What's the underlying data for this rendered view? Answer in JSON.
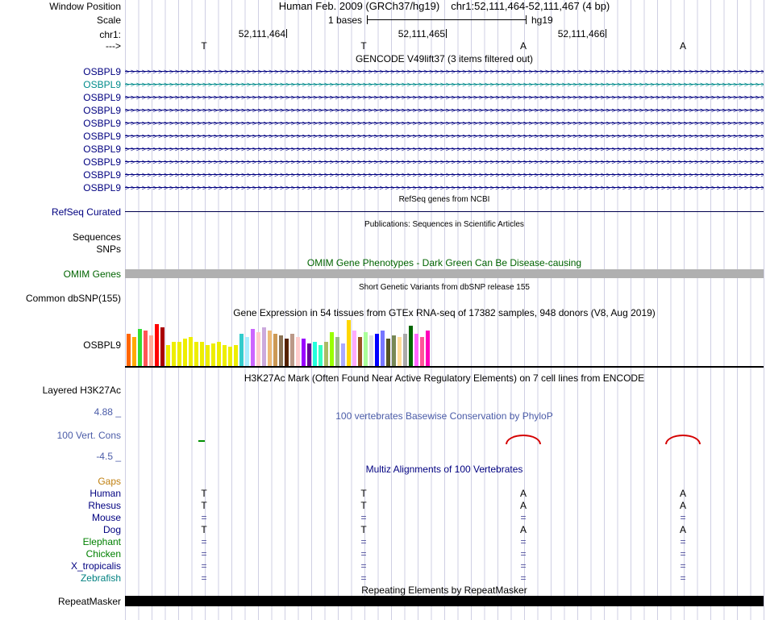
{
  "header": {
    "window_position_label": "Window Position",
    "assembly_title": "Human Feb. 2009 (GRCh37/hg19)",
    "position_title": "chr1:52,111,464-52,111,467 (4 bp)",
    "scale_label": "Scale",
    "scale_value": "1 bases",
    "assembly_tag": "hg19",
    "chrom_label": "chr1:",
    "coordinates": [
      "52,111,464",
      "52,111,465",
      "52,111,466"
    ],
    "strand_label": "--->",
    "bases": [
      "T",
      "T",
      "A",
      "A"
    ]
  },
  "tracks": {
    "gencode": {
      "title": "GENCODE V49lift37 (3 items filtered out)",
      "genes": [
        {
          "label": "OSBPL9",
          "color": "#000080"
        },
        {
          "label": "OSBPL9",
          "color": "#008b8b"
        },
        {
          "label": "OSBPL9",
          "color": "#000080"
        },
        {
          "label": "OSBPL9",
          "color": "#000080"
        },
        {
          "label": "OSBPL9",
          "color": "#000080"
        },
        {
          "label": "OSBPL9",
          "color": "#000080"
        },
        {
          "label": "OSBPL9",
          "color": "#000080"
        },
        {
          "label": "OSBPL9",
          "color": "#000080"
        },
        {
          "label": "OSBPL9",
          "color": "#000080"
        },
        {
          "label": "OSBPL9",
          "color": "#000080"
        }
      ]
    },
    "refseq": {
      "title": "RefSeq genes from NCBI",
      "label": "RefSeq Curated"
    },
    "publications": {
      "title": "Publications: Sequences in Scientific Articles",
      "labels": [
        "Sequences",
        "SNPs"
      ]
    },
    "omim": {
      "title": "OMIM Gene Phenotypes - Dark Green Can Be Disease-causing",
      "label": "OMIM Genes"
    },
    "dbsnp": {
      "title": "Short Genetic Variants from dbSNP release 155",
      "label": "Common dbSNP(155)"
    },
    "gtex": {
      "title": "Gene Expression in 54 tissues from GTEx RNA-seq of 17382 samples, 948 donors (V8, Aug 2019)",
      "label": "OSBPL9"
    },
    "h3k27ac": {
      "title": "H3K27Ac Mark (Often Found Near Active Regulatory Elements) on 7 cell lines from ENCODE",
      "label": "Layered H3K27Ac"
    },
    "conservation": {
      "title": "100 vertebrates Basewise Conservation by PhyloP",
      "label": "100 Vert. Cons",
      "max_label": "4.88 _",
      "min_label": "-4.5 _"
    },
    "multiz": {
      "title": "Multiz Alignments of 100 Vertebrates",
      "species": [
        {
          "name": "Gaps",
          "color": "#c08010",
          "cells": [
            "",
            "",
            "",
            ""
          ]
        },
        {
          "name": "Human",
          "color": "#000080",
          "cells": [
            "T",
            "T",
            "A",
            "A"
          ]
        },
        {
          "name": "Rhesus",
          "color": "#000080",
          "cells": [
            "T",
            "T",
            "A",
            "A"
          ]
        },
        {
          "name": "Mouse",
          "color": "#000080",
          "cells": [
            "=",
            "=",
            "=",
            "="
          ]
        },
        {
          "name": "Dog",
          "color": "#000080",
          "cells": [
            "T",
            "T",
            "A",
            "A"
          ]
        },
        {
          "name": "Elephant",
          "color": "#008000",
          "cells": [
            "=",
            "=",
            "=",
            "="
          ]
        },
        {
          "name": "Chicken",
          "color": "#008000",
          "cells": [
            "=",
            "=",
            "=",
            "="
          ]
        },
        {
          "name": "X_tropicalis",
          "color": "#000080",
          "cells": [
            "=",
            "=",
            "=",
            "="
          ]
        },
        {
          "name": "Zebrafish",
          "color": "#008080",
          "cells": [
            "=",
            "=",
            "=",
            "="
          ]
        }
      ]
    },
    "repeatmasker": {
      "title": "Repeating Elements by RepeatMasker",
      "label": "RepeatMasker"
    }
  },
  "chart_data": {
    "type": "bar",
    "title": "Gene Expression in 54 tissues from GTEx RNA-seq of 17382 samples, 948 donors (V8, Aug 2019)",
    "gene": "OSBPL9",
    "note": "54 GTEx tissue bars; tissue names not rendered in screenshot; values are relative expression bar heights in px",
    "values": [
      40,
      36,
      46,
      44,
      38,
      52,
      48,
      26,
      30,
      30,
      34,
      36,
      30,
      30,
      26,
      28,
      30,
      26,
      24,
      26,
      40,
      36,
      46,
      42,
      48,
      44,
      40,
      38,
      34,
      40,
      36,
      34,
      28,
      30,
      26,
      30,
      42,
      36,
      28,
      57,
      44,
      36,
      42,
      38,
      40,
      44,
      34,
      38,
      36,
      40,
      50,
      40,
      36,
      44
    ],
    "colors": [
      "#FF6600",
      "#FFAA00",
      "#33DD33",
      "#FF5555",
      "#FFAA99",
      "#FF0000",
      "#AA0000",
      "#EEEE00",
      "#EEEE00",
      "#EEEE00",
      "#EEEE00",
      "#EEEE00",
      "#EEEE00",
      "#EEEE00",
      "#EEEE00",
      "#EEEE00",
      "#EEEE00",
      "#EEEE00",
      "#EEEE00",
      "#EEEE00",
      "#33CCCC",
      "#AAEEFF",
      "#CC66FF",
      "#FFCCCC",
      "#CCAADD",
      "#EEBB77",
      "#CC9955",
      "#8B7355",
      "#552200",
      "#BB9988",
      "#FFCCCC",
      "#9900FF",
      "#660099",
      "#22FFDD",
      "#33FFC2",
      "#AABB66",
      "#99FF00",
      "#99BB88",
      "#AAAAFF",
      "#FFD700",
      "#FFAAFF",
      "#995522",
      "#AAFF99",
      "#DDDDDD",
      "#0000FF",
      "#7777FF",
      "#555522",
      "#778855",
      "#FFDD99",
      "#AAAAAA",
      "#006600",
      "#FF66FF",
      "#FF5599",
      "#FF00BB"
    ]
  }
}
